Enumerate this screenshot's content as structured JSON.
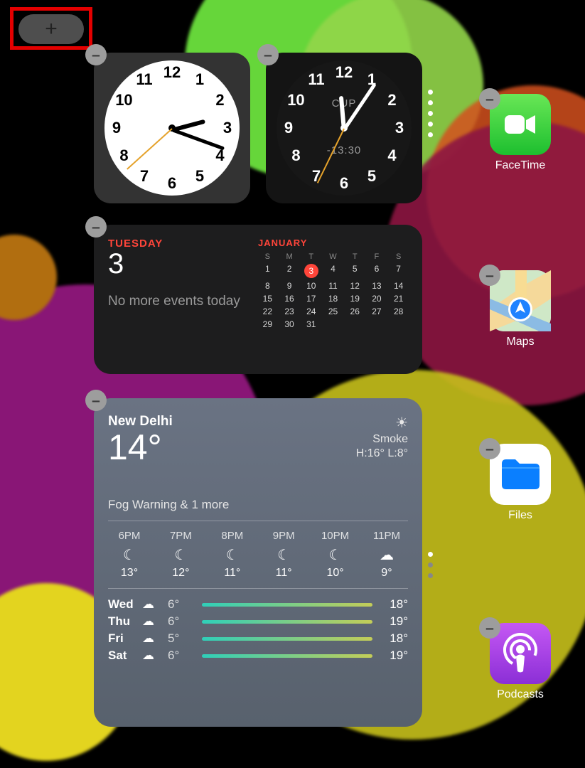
{
  "add_button": {
    "glyph": "+"
  },
  "clocks": {
    "white": {
      "hours": [
        "12",
        "1",
        "2",
        "3",
        "4",
        "5",
        "6",
        "7",
        "8",
        "9",
        "10",
        "11"
      ]
    },
    "dark": {
      "hours": [
        "12",
        "1",
        "2",
        "3",
        "4",
        "5",
        "6",
        "7",
        "8",
        "9",
        "10",
        "11"
      ],
      "city": "CUP",
      "offset": "-13:30"
    }
  },
  "time": {
    "hour_angle": 75,
    "minute_angle": 110,
    "second_angle": 228
  },
  "time_dark": {
    "hour_angle": -5,
    "minute_angle": 34,
    "second_angle": 206
  },
  "calendar": {
    "day_name": "TUESDAY",
    "day_num": "3",
    "message": "No more events today",
    "month": "JANUARY",
    "dow": [
      "S",
      "M",
      "T",
      "W",
      "T",
      "F",
      "S"
    ],
    "weeks": [
      [
        "1",
        "2",
        "3",
        "4",
        "5",
        "6",
        "7"
      ],
      [
        "8",
        "9",
        "10",
        "11",
        "12",
        "13",
        "14"
      ],
      [
        "15",
        "16",
        "17",
        "18",
        "19",
        "20",
        "21"
      ],
      [
        "22",
        "23",
        "24",
        "25",
        "26",
        "27",
        "28"
      ],
      [
        "29",
        "30",
        "31",
        "",
        "",
        "",
        ""
      ]
    ],
    "today": "3"
  },
  "weather": {
    "city": "New Delhi",
    "temp": "14°",
    "condition": "Smoke",
    "hilo": "H:16° L:8°",
    "alert": "Fog Warning & 1 more",
    "hours": [
      {
        "t": "6PM",
        "icon": "☾",
        "temp": "13°"
      },
      {
        "t": "7PM",
        "icon": "☾",
        "temp": "12°"
      },
      {
        "t": "8PM",
        "icon": "☾",
        "temp": "11°"
      },
      {
        "t": "9PM",
        "icon": "☾",
        "temp": "11°"
      },
      {
        "t": "10PM",
        "icon": "☾",
        "temp": "10°"
      },
      {
        "t": "11PM",
        "icon": "☁",
        "temp": "9°"
      }
    ],
    "days": [
      {
        "d": "Wed",
        "icon": "☁",
        "lo": "6°",
        "hi": "18°"
      },
      {
        "d": "Thu",
        "icon": "☁",
        "lo": "6°",
        "hi": "19°"
      },
      {
        "d": "Fri",
        "icon": "☁",
        "lo": "5°",
        "hi": "18°"
      },
      {
        "d": "Sat",
        "icon": "☁",
        "lo": "6°",
        "hi": "19°"
      }
    ],
    "sun_icon": "☀"
  },
  "apps": {
    "facetime": "FaceTime",
    "maps": "Maps",
    "files": "Files",
    "podcasts": "Podcasts"
  },
  "minus": "–"
}
